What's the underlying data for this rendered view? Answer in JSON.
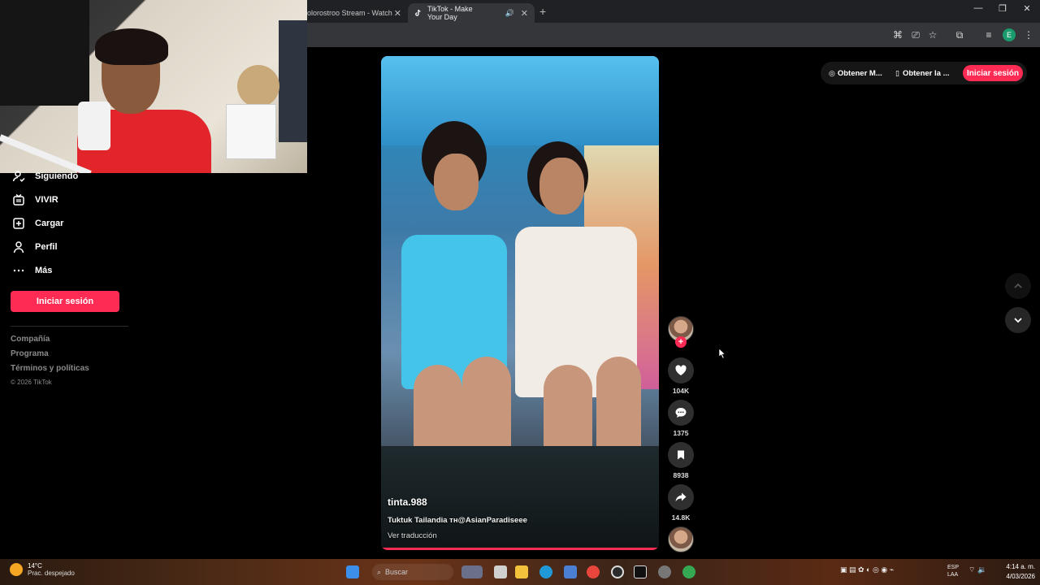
{
  "browser": {
    "tabs": [
      {
        "title": "olorostroo Stream - Watch",
        "active": false
      },
      {
        "title": "TikTok - Make Your Day",
        "active": true
      }
    ],
    "profile_initial": "E"
  },
  "sidebar": {
    "items": [
      {
        "label": "Siguiendo",
        "icon": "user-follow-icon"
      },
      {
        "label": "VIVIR",
        "icon": "live-icon"
      },
      {
        "label": "Cargar",
        "icon": "upload-icon"
      },
      {
        "label": "Perfil",
        "icon": "profile-icon"
      },
      {
        "label": "Más",
        "icon": "more-icon"
      }
    ],
    "login_label": "Iniciar sesión",
    "footer": [
      "Compañía",
      "Programa",
      "Términos y políticas"
    ],
    "copyright": "© 2026 TikTok"
  },
  "topbar": {
    "get_app_label": "Obtener M...",
    "get_desktop_label": "Obtener la ...",
    "login_label": "Iniciar sesión"
  },
  "video": {
    "username": "tinta.988",
    "caption": "Tuktuk Tailandia ᴛʜ@AsianParadiseee",
    "translate_label": "Ver traducción",
    "progress": 1.0
  },
  "actions": {
    "likes": "104K",
    "comments": "1375",
    "saves": "8938",
    "shares": "14.8K"
  },
  "taskbar": {
    "temperature": "14°C",
    "weather": "Prac. despejado",
    "search_placeholder": "Buscar",
    "lang_top": "ESP",
    "lang_bottom": "LAA",
    "time": "4:14 a. m.",
    "date": "4/03/2026"
  },
  "colors": {
    "accent": "#fe2c55",
    "background": "#000000"
  }
}
